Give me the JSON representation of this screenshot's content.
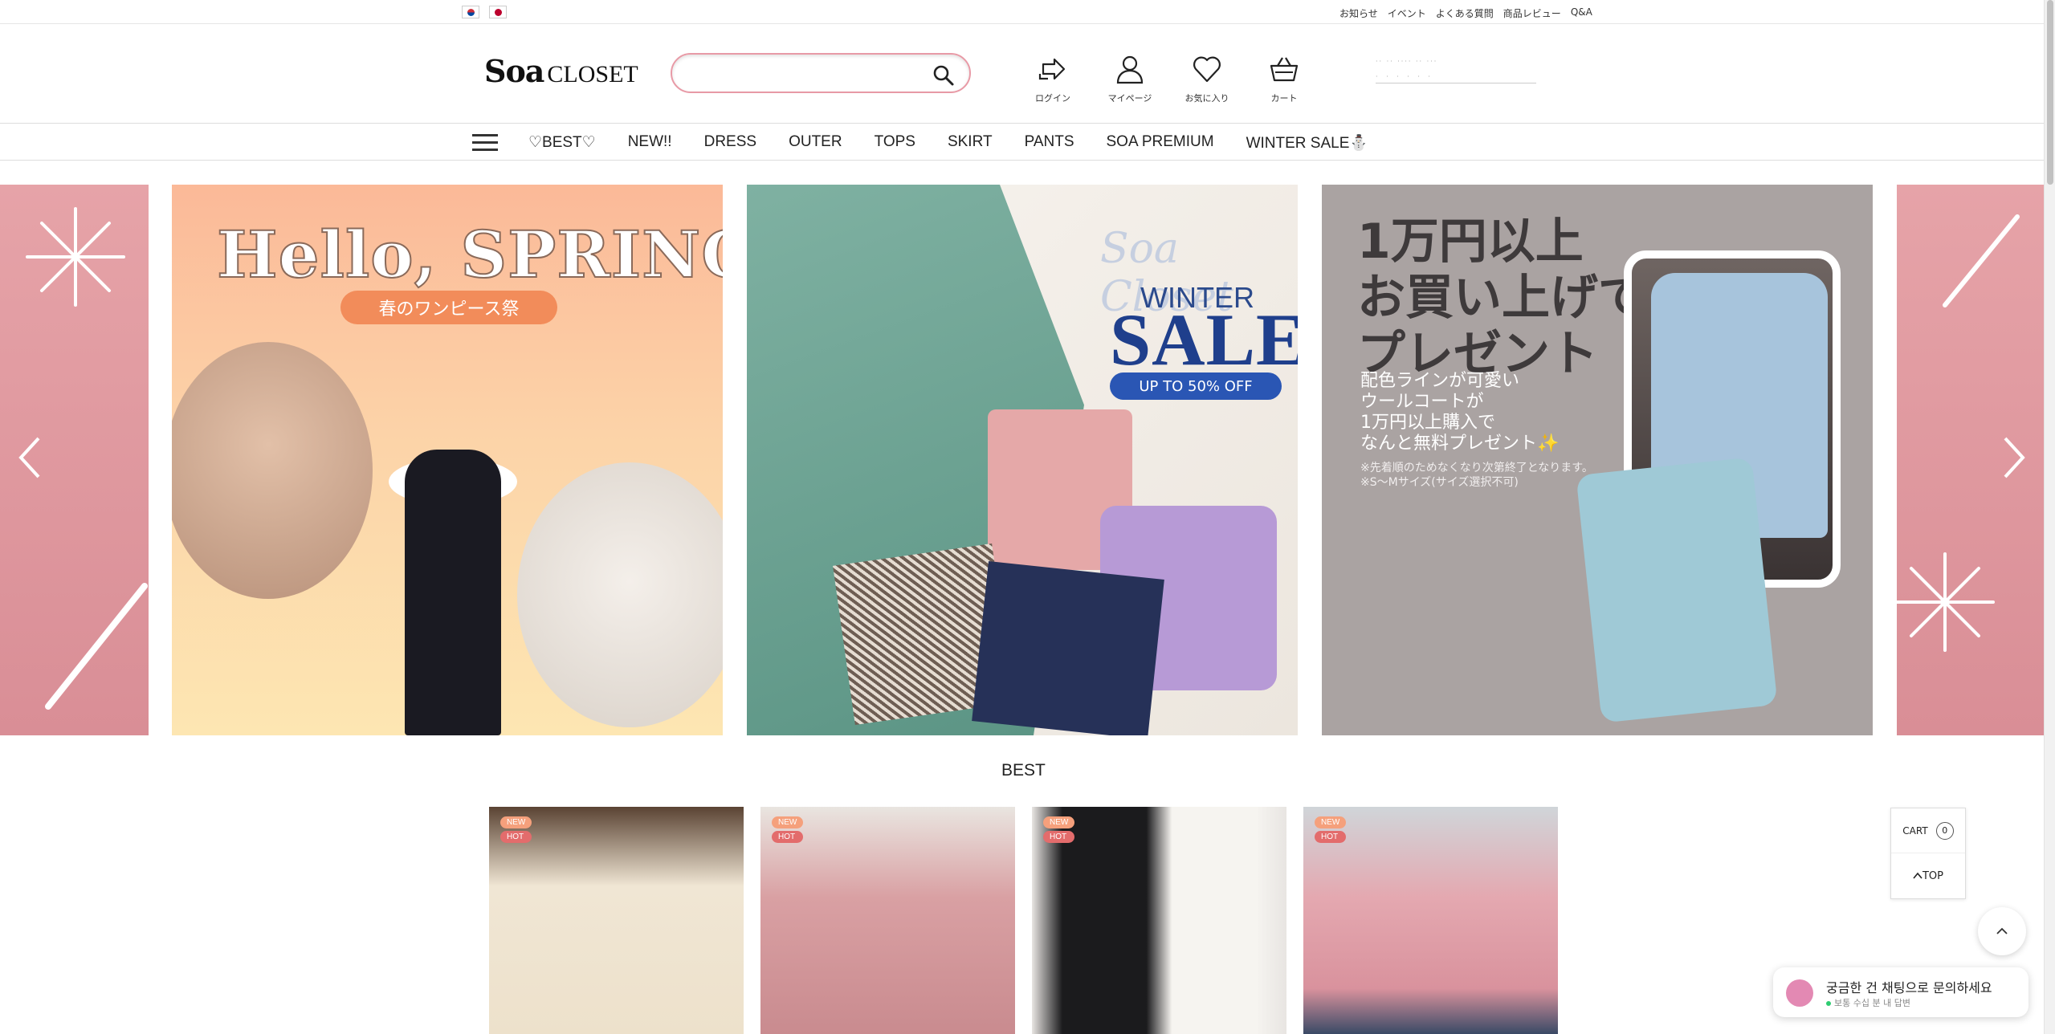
{
  "topbar": {
    "flags": [
      "kr-flag",
      "jp-flag"
    ],
    "links": [
      "お知らせ",
      "イベント",
      "よくある質問",
      "商品レビュー",
      "Q&A"
    ]
  },
  "header": {
    "logo_soa": "Soa",
    "logo_closet": "CLOSET",
    "search_placeholder": "",
    "icons": [
      {
        "icon": "login-icon",
        "label": "ログイン"
      },
      {
        "icon": "person-icon",
        "label": "マイページ"
      },
      {
        "icon": "heart-icon",
        "label": "お気に入り"
      },
      {
        "icon": "basket-icon",
        "label": "カート"
      }
    ],
    "accent_color": "#e89aa6"
  },
  "nav": {
    "items": [
      "♡BEST♡",
      "NEW!!",
      "DRESS",
      "OUTER",
      "TOPS",
      "SKIRT",
      "PANTS",
      "SOA PREMIUM",
      "WINTER SALE⛄"
    ]
  },
  "banner": {
    "slide1": {
      "title": "Hello, SPRING",
      "subtitle": "春のワンピース祭"
    },
    "slide2": {
      "brand": "Soa Closet",
      "winter": "WINTER",
      "sale": "SALE",
      "badge": "UP TO 50% OFF"
    },
    "slide3": {
      "heading": [
        "1万円以上",
        "お買い上げで",
        "プレゼント"
      ],
      "body": [
        "配色ラインが可愛い",
        "ウールコートが",
        "1万円以上購入で",
        "なんと無料プレゼント✨"
      ],
      "notes": [
        "※先着順のためなくなり次第終了となります。",
        "※S～Mサイズ(サイズ選択不可)"
      ]
    }
  },
  "best": {
    "title": "BEST",
    "products": [
      {
        "badges": [
          "NEW",
          "HOT"
        ]
      },
      {
        "badges": [
          "NEW",
          "HOT"
        ]
      },
      {
        "badges": [
          "NEW",
          "HOT"
        ]
      },
      {
        "badges": [
          "NEW",
          "HOT"
        ]
      }
    ]
  },
  "floating": {
    "cart_label": "CART",
    "cart_count": "0",
    "top_label": "TOP",
    "chat_title": "궁금한 건 채팅으로 문의하세요",
    "chat_sub": "보통 수십 분 내 답변"
  }
}
